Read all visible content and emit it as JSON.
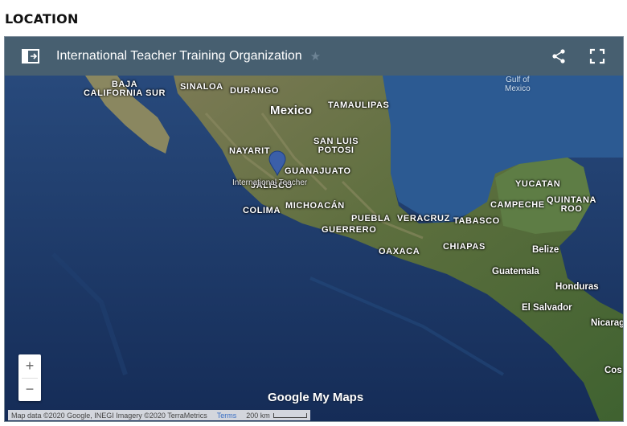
{
  "section_title": "LOCATION",
  "map": {
    "title": "International Teacher Training Organization",
    "labels": {
      "baja": "BAJA\nCALIFORNIA SUR",
      "sinaloa": "SINALOA",
      "durango": "DURANGO",
      "mexico": "Mexico",
      "tamaulipas": "TAMAULIPAS",
      "gulf": "Gulf of\nMexico",
      "san_luis": "SAN LUIS\nPOTOSI",
      "nayarit": "NAYARIT",
      "guanajuato": "GUANAJUATO",
      "jalisco": "JALISCO",
      "pin_label": "International Teacher",
      "colima": "COLIMA",
      "michoacan": "MICHOACÁN",
      "puebla": "PUEBLA",
      "veracruz": "VERACRUZ",
      "tabasco": "TABASCO",
      "guerrero": "GUERRERO",
      "oaxaca": "OAXACA",
      "chiapas": "CHIAPAS",
      "yucatan": "YUCATAN",
      "campeche": "CAMPECHE",
      "quintana": "QUINTANA\nROO",
      "belize": "Belize",
      "guatemala": "Guatemala",
      "honduras": "Honduras",
      "el_salvador": "El Salvador",
      "nicaragua": "Nicarag",
      "costa": "Cos"
    },
    "zoom_in": "+",
    "zoom_out": "−",
    "logo": "Google My Maps",
    "attribution": "Map data ©2020 Google, INEGI Imagery ©2020 TerraMetrics",
    "terms": "Terms",
    "scale": "200 km"
  },
  "colors": {
    "ocean": "#1d3a6a",
    "land": "#4f6a3a",
    "titlebar": "#496070",
    "pin": "#3b5fa8"
  },
  "icons": [
    "panel-icon",
    "star-icon",
    "share-icon",
    "fullscreen-icon",
    "map-pin-icon"
  ]
}
